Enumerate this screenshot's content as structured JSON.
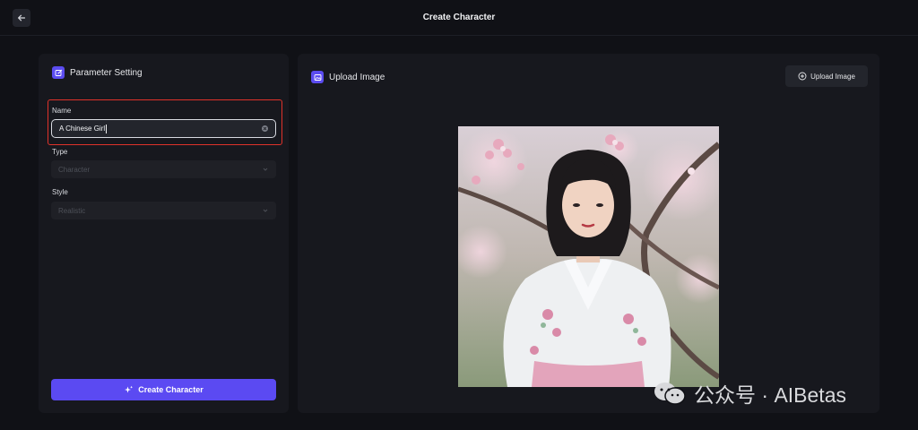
{
  "header": {
    "title": "Create Character",
    "back_icon": "arrow-left-icon"
  },
  "left_panel": {
    "title": "Parameter Setting",
    "title_icon": "edit-icon",
    "name_field": {
      "label": "Name",
      "value": "A Chinese Girl"
    },
    "type_field": {
      "label": "Type",
      "value": "Character"
    },
    "style_field": {
      "label": "Style",
      "value": "Realistic"
    },
    "create_button": {
      "label": "Create Character",
      "icon": "sparkle-icon"
    }
  },
  "right_panel": {
    "title": "Upload Image",
    "title_icon": "image-icon",
    "upload_button": {
      "label": "Upload Image",
      "icon": "plus-circle-icon"
    }
  },
  "watermark": {
    "text": "公众号 · AIBetas",
    "icon": "wechat-icon"
  },
  "colors": {
    "accent": "#5b4af2",
    "highlight": "#e0322a",
    "background": "#101116",
    "panel": "#17181e"
  }
}
